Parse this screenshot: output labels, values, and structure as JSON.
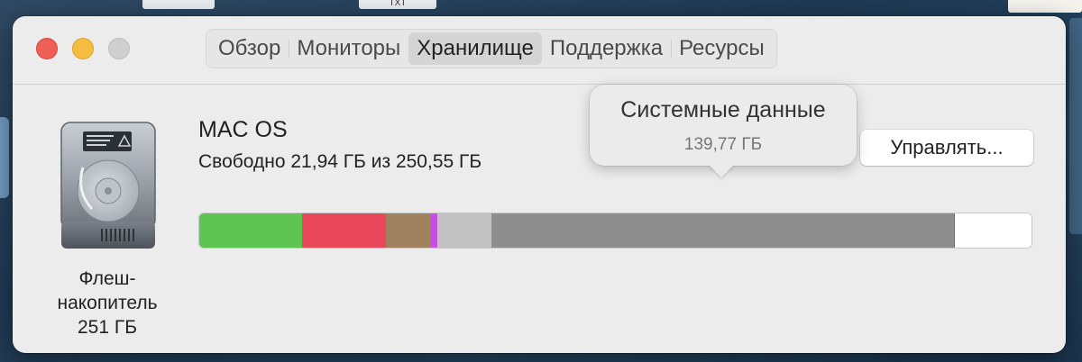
{
  "desktop": {
    "thumb_text": "TXT"
  },
  "tabs": [
    {
      "label": "Обзор",
      "active": false
    },
    {
      "label": "Мониторы",
      "active": false
    },
    {
      "label": "Хранилище",
      "active": true
    },
    {
      "label": "Поддержка",
      "active": false
    },
    {
      "label": "Ресурсы",
      "active": false
    }
  ],
  "disk": {
    "icon": "hard-drive-icon",
    "label_line1": "Флеш-",
    "label_line2": "накопитель",
    "label_line3": "251 ГБ"
  },
  "volume": {
    "name": "MAC OS",
    "free_text": "Свободно 21,94 ГБ из 250,55 ГБ",
    "manage_label": "Управлять..."
  },
  "tooltip": {
    "title": "Системные данные",
    "value": "139,77 ГБ"
  },
  "storage_bar": {
    "segments": [
      {
        "name": "green",
        "color": "#5ec552",
        "fraction": 0.124
      },
      {
        "name": "red",
        "color": "#e9475a",
        "fraction": 0.1
      },
      {
        "name": "brown",
        "color": "#a0815f",
        "fraction": 0.055
      },
      {
        "name": "magenta",
        "color": "#c64fe0",
        "fraction": 0.007
      },
      {
        "name": "light-gray",
        "color": "#c2c2c2",
        "fraction": 0.065
      },
      {
        "name": "system-data",
        "color": "#8e8e8e",
        "fraction": 0.557
      },
      {
        "name": "free",
        "color": "#ffffff",
        "fraction": 0.092
      }
    ]
  }
}
